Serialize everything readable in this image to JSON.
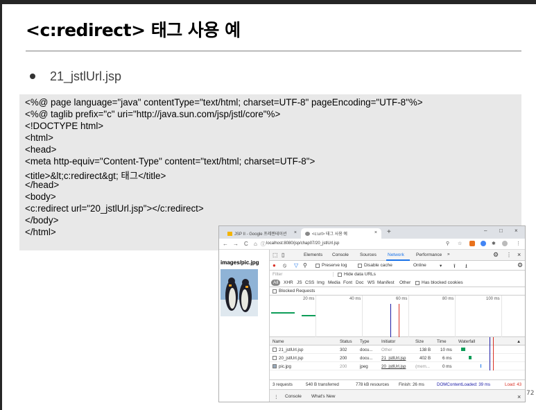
{
  "slide": {
    "title": "<c:redirect> 태그 사용 예",
    "bullet": "21_jstlUrl.jsp",
    "page_number": "72",
    "code_lines": [
      "<%@ page language=\"java\" contentType=\"text/html; charset=UTF-8\" pageEncoding=\"UTF-8\"%>",
      "<%@ taglib prefix=\"c\" uri=\"http://java.sun.com/jsp/jstl/core\"%>",
      "<!DOCTYPE html>",
      "<html>",
      "<head>",
      "<meta http-equiv=\"Content-Type\" content=\"text/html; charset=UTF-8\">",
      "<title>&lt;c:redirect&gt; 태그</title>",
      "</head>",
      "<body>",
      "      <c:redirect url=\"20_jstlUrl.jsp\"></c:redirect>",
      "</body>",
      "</html>"
    ]
  },
  "browser": {
    "tabs": [
      {
        "label": "JSP II - Google 프레젠테이션",
        "close": "×"
      },
      {
        "label": "<c:url> 태그 사용 예",
        "close": "×"
      }
    ],
    "new_tab": "+",
    "window_controls": [
      "–",
      "□",
      "×"
    ],
    "nav": [
      "←",
      "→",
      "C",
      "⌂"
    ],
    "url": "localhost:8080/jsp/chap07/20_jstlUrl.jsp",
    "page_label": "images/pic.jpg",
    "devtools": {
      "tabs": [
        "Elements",
        "Console",
        "Sources",
        "Network",
        "Performance",
        "»"
      ],
      "active_tab": "Network",
      "toolbar": {
        "preserve_log": "Preserve log",
        "disable_cache": "Disable cache",
        "throttle": "Online"
      },
      "filter_placeholder": "Filter",
      "hide_data_urls": "Hide data URLs",
      "type_filters": [
        "All",
        "XHR",
        "JS",
        "CSS",
        "Img",
        "Media",
        "Font",
        "Doc",
        "WS",
        "Manifest",
        "Other"
      ],
      "has_blocked_cookies": "Has blocked cookies",
      "blocked_requests": "Blocked Requests",
      "timeline_ticks": [
        "20 ms",
        "40 ms",
        "60 ms",
        "80 ms",
        "100 ms"
      ],
      "columns": [
        "Name",
        "Status",
        "Type",
        "Initiator",
        "Size",
        "Time",
        "Waterfall"
      ],
      "rows": [
        {
          "name": "21_jstlUrl.jsp",
          "status": "302",
          "type": "docu...",
          "initiator": "Other",
          "size": "138 B",
          "time": "10 ms"
        },
        {
          "name": "20_jstlUrl.jsp",
          "status": "200",
          "type": "docu...",
          "initiator": "21_jstlUrl.jsp",
          "size": "402 B",
          "time": "6 ms"
        },
        {
          "name": "pic.jpg",
          "status": "200",
          "type": "jpeg",
          "initiator": "20_jstlUrl.jsp",
          "size": "(mem...",
          "time": "0 ms"
        }
      ],
      "status_bar": {
        "requests": "3 requests",
        "transferred": "540 B transferred",
        "resources": "778 kB resources",
        "finish": "Finish: 26 ms",
        "dcl": "DOMContentLoaded: 39 ms",
        "load": "Load: 43"
      },
      "drawer_tabs": [
        "Console",
        "What's New"
      ],
      "drawer_close": "×"
    }
  },
  "colors": {
    "accent": "#1a73e8",
    "dcl": "#1a1aa6",
    "load": "#d93025",
    "waterfall_green": "#0c9d58"
  }
}
